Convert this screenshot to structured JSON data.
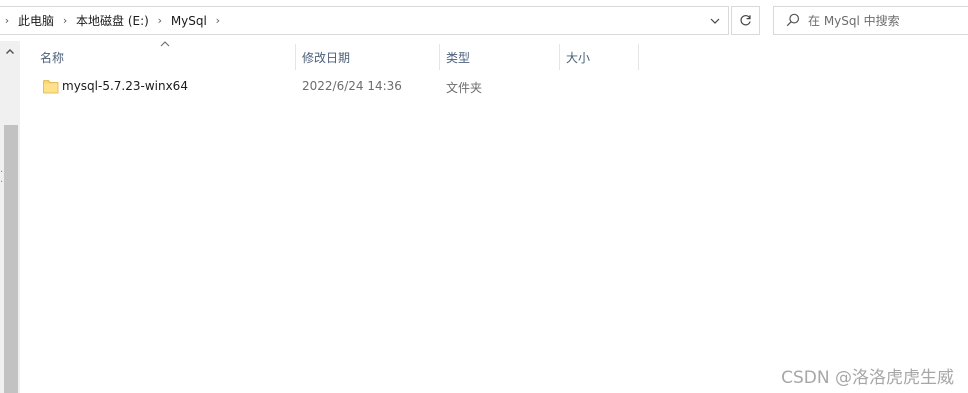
{
  "address_bar": {
    "crumbs": [
      "此电脑",
      "本地磁盘 (E:)",
      "MySql"
    ]
  },
  "search": {
    "placeholder": "在 MySql 中搜索"
  },
  "columns": {
    "name": "名称",
    "date_modified": "修改日期",
    "type": "类型",
    "size": "大小"
  },
  "files": [
    {
      "name": "mysql-5.7.23-winx64",
      "date_modified": "2022/6/24 14:36",
      "type": "文件夹",
      "size": "",
      "icon": "folder-icon"
    }
  ],
  "watermark": "CSDN @洛洛虎虎生威",
  "colors": {
    "folder_yellow": "#f7d674",
    "column_header_text": "#4c607a",
    "scrollbar_thumb": "#c2c2c2"
  }
}
